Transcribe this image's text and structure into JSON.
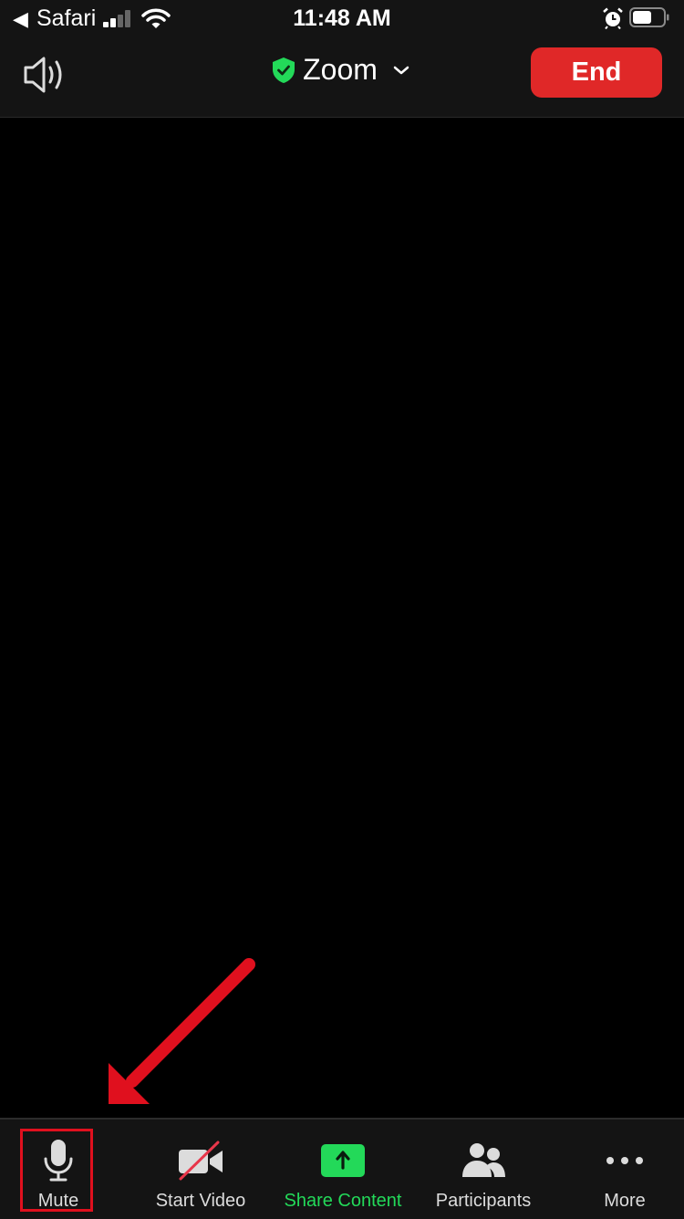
{
  "status_bar": {
    "back_label": "◀",
    "app_name": "Safari",
    "time": "11:48 AM",
    "signal_bars_active": 2,
    "signal_bars_total": 4,
    "battery_level_percent": 60,
    "icons": [
      "back-arrow-icon",
      "signal-icon",
      "wifi-icon",
      "alarm-icon",
      "battery-icon"
    ]
  },
  "top_bar": {
    "speaker_icon": "speaker-icon",
    "title": "Zoom",
    "shield_icon": "shield-check-icon",
    "dropdown_icon": "chevron-down-icon",
    "end_label": "End"
  },
  "colors": {
    "end_button": "#e02828",
    "shield": "#23d959",
    "share_accent": "#23d959",
    "annotation": "#e0101e",
    "bar_background": "#141414"
  },
  "toolbar": {
    "items": [
      {
        "label": "Mute",
        "icon": "microphone-icon"
      },
      {
        "label": "Start Video",
        "icon": "video-off-icon"
      },
      {
        "label": "Share Content",
        "icon": "share-upload-icon"
      },
      {
        "label": "Participants",
        "icon": "participants-icon"
      },
      {
        "label": "More",
        "icon": "more-dots-icon"
      }
    ]
  },
  "annotations": {
    "arrow": "red-arrow-pointing-to-mute",
    "highlight": "red-box-around-mute"
  }
}
